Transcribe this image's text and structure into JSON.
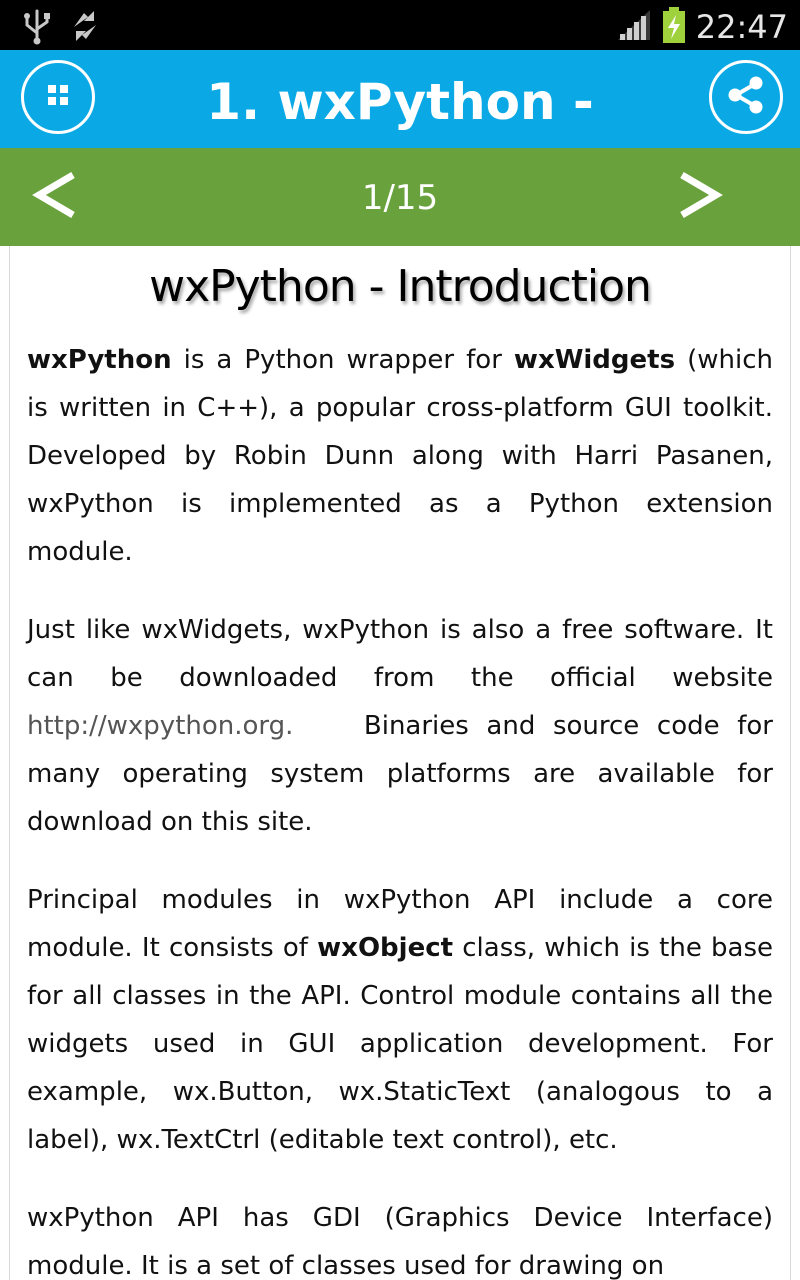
{
  "status_bar": {
    "time": "22:47",
    "icons": [
      "usb-icon",
      "sync-icon",
      "signal-icon",
      "battery-charging-icon"
    ]
  },
  "app_bar": {
    "title": "1. wxPython -",
    "menu_icon": "grid-menu-icon",
    "share_icon": "share-icon",
    "color": "#0aa9e6"
  },
  "nav_bar": {
    "prev_icon": "chevron-left-icon",
    "next_icon": "chevron-right-icon",
    "page_indicator": "1/15",
    "color": "#69a23c"
  },
  "content": {
    "title": "wxPython - Introduction",
    "p1": {
      "b1": "wxPython",
      "t1": " is a Python wrapper for ",
      "b2": "wxWidgets",
      "t2": " (which is written in C++), a popular cross-platform GUI toolkit. Developed by Robin Dunn along with Harri Pasanen, wxPython is implemented as a Python extension module."
    },
    "p2": {
      "t1": "Just like wxWidgets, wxPython is also a free software. It can be downloaded from the official website ",
      "link": "http://wxpython.org.",
      "t2": "    Binaries and source code for many operating system platforms are available for download on this site."
    },
    "p3": {
      "t1": "Principal modules in wxPython API include a core module. It consists of ",
      "b1": "wxObject",
      "t2": " class, which is the base for all classes in the API. Control module contains all the widgets used in GUI application development. For example, wx.Button, wx.StaticText (analogous to a label), wx.TextCtrl (editable text control), etc."
    },
    "p4": {
      "t1": "wxPython API has GDI (Graphics Device Interface) module. It is a set of classes used for drawing on"
    }
  }
}
